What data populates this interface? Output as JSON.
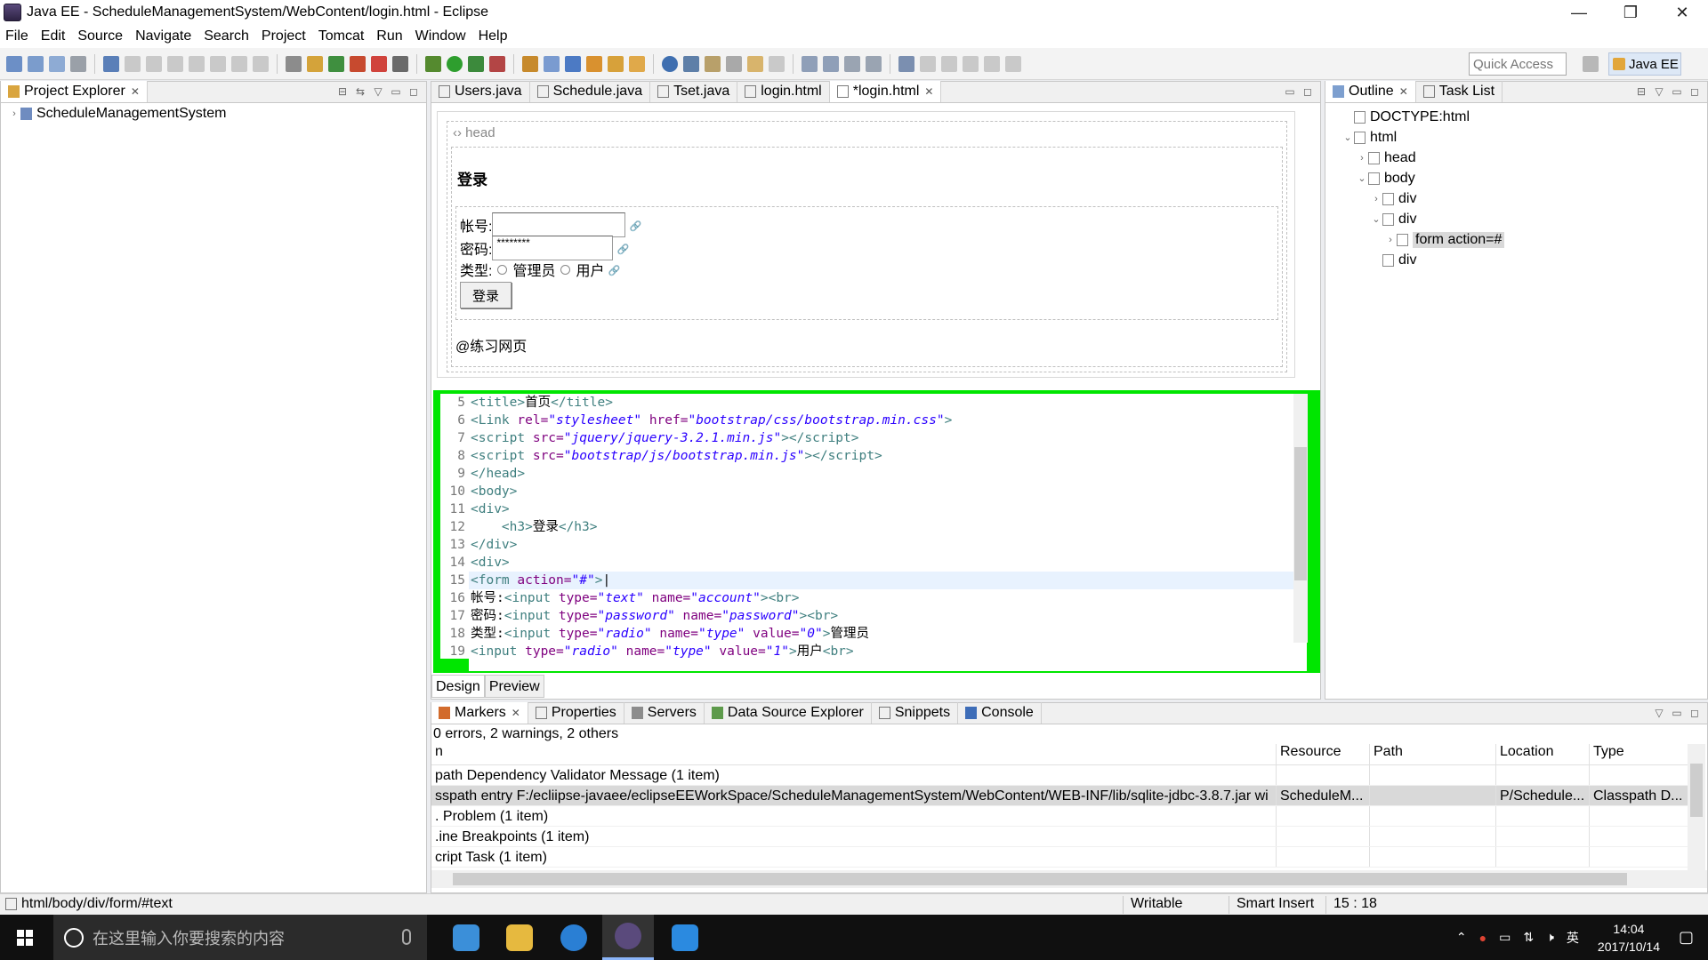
{
  "window": {
    "title": "Java EE - ScheduleManagementSystem/WebContent/login.html - Eclipse",
    "minimize": "—",
    "restore": "❐",
    "close": "✕"
  },
  "menu": [
    "File",
    "Edit",
    "Source",
    "Navigate",
    "Search",
    "Project",
    "Tomcat",
    "Run",
    "Window",
    "Help"
  ],
  "toolbar": {
    "quick_access_placeholder": "Quick Access",
    "perspective": "Java EE"
  },
  "project_explorer": {
    "tab": "Project Explorer",
    "project": "ScheduleManagementSystem"
  },
  "editor": {
    "tabs": [
      {
        "label": "Users.java",
        "active": false
      },
      {
        "label": "Schedule.java",
        "active": false
      },
      {
        "label": "Tset.java",
        "active": false
      },
      {
        "label": "login.html",
        "active": false
      },
      {
        "label": "*login.html",
        "active": true
      }
    ],
    "design": {
      "head_label": "head",
      "h3": "登录",
      "account_label": "帐号:",
      "password_label": "密码:",
      "password_value": "********",
      "type_label": "类型:",
      "radio_admin": "管理员",
      "radio_user": "用户",
      "login_button": "登录",
      "footer": "@练习网页"
    },
    "code_lines": [
      {
        "n": "5",
        "html": "<span class='tag'>&lt;title&gt;</span><span class='txt'>首页</span><span class='tag'>&lt;/title&gt;</span>"
      },
      {
        "n": "6",
        "html": "<span class='tag'>&lt;Link </span><span class='attr'>rel=</span><span class='val'>\"stylesheet\"</span> <span class='attr'>href=</span><span class='val'>\"bootstrap/css/bootstrap.min.css\"</span><span class='tag'>&gt;</span>"
      },
      {
        "n": "7",
        "html": "<span class='tag'>&lt;script </span><span class='attr'>src=</span><span class='val'>\"jquery/jquery-3.2.1.min.js\"</span><span class='tag'>&gt;&lt;/script&gt;</span>"
      },
      {
        "n": "8",
        "html": "<span class='tag'>&lt;script </span><span class='attr'>src=</span><span class='val'>\"bootstrap/js/bootstrap.min.js\"</span><span class='tag'>&gt;&lt;/script&gt;</span>"
      },
      {
        "n": "9",
        "html": "<span class='tag'>&lt;/head&gt;</span>"
      },
      {
        "n": "10",
        "html": "<span class='tag'>&lt;body&gt;</span>"
      },
      {
        "n": "11",
        "html": "<span class='tag'>&lt;div&gt;</span>"
      },
      {
        "n": "12",
        "html": "    <span class='tag'>&lt;h3&gt;</span><span class='txt'>登录</span><span class='tag'>&lt;/h3&gt;</span>"
      },
      {
        "n": "13",
        "html": "<span class='tag'>&lt;/div&gt;</span>"
      },
      {
        "n": "14",
        "html": "<span class='tag'>&lt;div&gt;</span>"
      },
      {
        "n": "15",
        "html": "<span class='tag'>&lt;form </span><span class='attr'>action=</span><span class='val'>\"#\"</span><span class='tag'>&gt;</span>|",
        "current": true
      },
      {
        "n": "16",
        "html": "<span class='txt'>帐号:</span><span class='tag'>&lt;input </span><span class='attr'>type=</span><span class='val'>\"text\"</span> <span class='attr'>name=</span><span class='val'>\"account\"</span><span class='tag'>&gt;&lt;br&gt;</span>"
      },
      {
        "n": "17",
        "html": "<span class='txt'>密码:</span><span class='tag'>&lt;input </span><span class='attr'>type=</span><span class='val'>\"password\"</span> <span class='attr'>name=</span><span class='val'>\"password\"</span><span class='tag'>&gt;&lt;br&gt;</span>"
      },
      {
        "n": "18",
        "html": "<span class='txt'>类型:</span><span class='tag'>&lt;input </span><span class='attr'>type=</span><span class='val'>\"radio\"</span> <span class='attr'>name=</span><span class='val'>\"type\"</span> <span class='attr'>value=</span><span class='val'>\"0\"</span><span class='tag'>&gt;</span><span class='txt'>管理员</span>"
      },
      {
        "n": "19",
        "html": "<span class='tag'>&lt;input </span><span class='attr'>type=</span><span class='val'>\"radio\"</span> <span class='attr'>name=</span><span class='val'>\"type\"</span> <span class='attr'>value=</span><span class='val'>\"1\"</span><span class='tag'>&gt;</span><span class='txt'>用户</span><span class='tag'>&lt;br&gt;</span>"
      }
    ],
    "bottom_tabs": {
      "design": "Design",
      "preview": "Preview"
    }
  },
  "outline": {
    "tabs": {
      "outline": "Outline",
      "task_list": "Task List"
    },
    "nodes": [
      {
        "label": "DOCTYPE:html",
        "depth": 0,
        "chev": ""
      },
      {
        "label": "html",
        "depth": 0,
        "chev": "⌄"
      },
      {
        "label": "head",
        "depth": 1,
        "chev": "›"
      },
      {
        "label": "body",
        "depth": 1,
        "chev": "⌄"
      },
      {
        "label": "div",
        "depth": 2,
        "chev": "›"
      },
      {
        "label": "div",
        "depth": 2,
        "chev": "⌄"
      },
      {
        "label": "form action=#",
        "depth": 3,
        "chev": "›",
        "selected": true
      },
      {
        "label": "div",
        "depth": 2,
        "chev": ""
      }
    ]
  },
  "markers": {
    "tabs": [
      "Markers",
      "Properties",
      "Servers",
      "Data Source Explorer",
      "Snippets",
      "Console"
    ],
    "summary": "0 errors, 2 warnings, 2 others",
    "columns": [
      "n",
      "Resource",
      "Path",
      "Location",
      "Type"
    ],
    "rows": [
      {
        "desc": "path Dependency Validator Message (1 item)",
        "resource": "",
        "path": "",
        "location": "",
        "type": ""
      },
      {
        "desc": "sspath entry F:/ecliipse-javaee/eclipseEEWorkSpace/ScheduleManagementSystem/WebContent/WEB-INF/lib/sqlite-jdbc-3.8.7.jar wi",
        "resource": "ScheduleM...",
        "path": "",
        "location": "P/Schedule...",
        "type": "Classpath D...",
        "selected": true
      },
      {
        "desc": ". Problem (1 item)",
        "resource": "",
        "path": "",
        "location": "",
        "type": ""
      },
      {
        "desc": ".ine Breakpoints (1 item)",
        "resource": "",
        "path": "",
        "location": "",
        "type": ""
      },
      {
        "desc": "cript Task (1 item)",
        "resource": "",
        "path": "",
        "location": "",
        "type": ""
      }
    ]
  },
  "status": {
    "path": "html/body/div/form/#text",
    "writable": "Writable",
    "insert_mode": "Smart Insert",
    "position": "15 : 18"
  },
  "taskbar": {
    "search_placeholder": "在这里输入你要搜索的内容",
    "time": "14:04",
    "date": "2017/10/14",
    "ime": "英",
    "volume": "🕨",
    "network": "⇅"
  }
}
